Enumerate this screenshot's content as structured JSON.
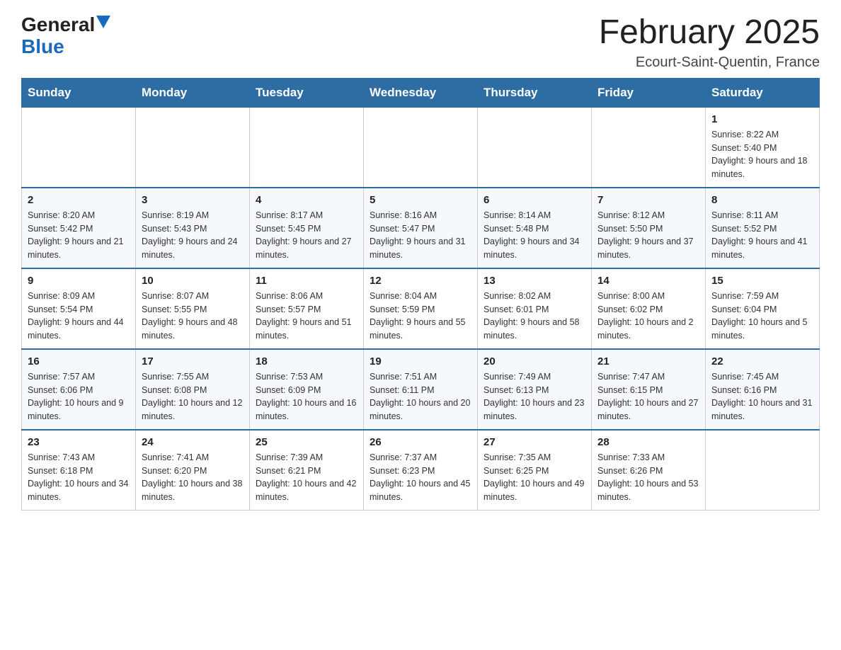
{
  "header": {
    "logo_general": "General",
    "logo_blue": "Blue",
    "month_title": "February 2025",
    "location": "Ecourt-Saint-Quentin, France"
  },
  "days_of_week": [
    "Sunday",
    "Monday",
    "Tuesday",
    "Wednesday",
    "Thursday",
    "Friday",
    "Saturday"
  ],
  "weeks": [
    [
      {
        "day": "",
        "info": ""
      },
      {
        "day": "",
        "info": ""
      },
      {
        "day": "",
        "info": ""
      },
      {
        "day": "",
        "info": ""
      },
      {
        "day": "",
        "info": ""
      },
      {
        "day": "",
        "info": ""
      },
      {
        "day": "1",
        "info": "Sunrise: 8:22 AM\nSunset: 5:40 PM\nDaylight: 9 hours and 18 minutes."
      }
    ],
    [
      {
        "day": "2",
        "info": "Sunrise: 8:20 AM\nSunset: 5:42 PM\nDaylight: 9 hours and 21 minutes."
      },
      {
        "day": "3",
        "info": "Sunrise: 8:19 AM\nSunset: 5:43 PM\nDaylight: 9 hours and 24 minutes."
      },
      {
        "day": "4",
        "info": "Sunrise: 8:17 AM\nSunset: 5:45 PM\nDaylight: 9 hours and 27 minutes."
      },
      {
        "day": "5",
        "info": "Sunrise: 8:16 AM\nSunset: 5:47 PM\nDaylight: 9 hours and 31 minutes."
      },
      {
        "day": "6",
        "info": "Sunrise: 8:14 AM\nSunset: 5:48 PM\nDaylight: 9 hours and 34 minutes."
      },
      {
        "day": "7",
        "info": "Sunrise: 8:12 AM\nSunset: 5:50 PM\nDaylight: 9 hours and 37 minutes."
      },
      {
        "day": "8",
        "info": "Sunrise: 8:11 AM\nSunset: 5:52 PM\nDaylight: 9 hours and 41 minutes."
      }
    ],
    [
      {
        "day": "9",
        "info": "Sunrise: 8:09 AM\nSunset: 5:54 PM\nDaylight: 9 hours and 44 minutes."
      },
      {
        "day": "10",
        "info": "Sunrise: 8:07 AM\nSunset: 5:55 PM\nDaylight: 9 hours and 48 minutes."
      },
      {
        "day": "11",
        "info": "Sunrise: 8:06 AM\nSunset: 5:57 PM\nDaylight: 9 hours and 51 minutes."
      },
      {
        "day": "12",
        "info": "Sunrise: 8:04 AM\nSunset: 5:59 PM\nDaylight: 9 hours and 55 minutes."
      },
      {
        "day": "13",
        "info": "Sunrise: 8:02 AM\nSunset: 6:01 PM\nDaylight: 9 hours and 58 minutes."
      },
      {
        "day": "14",
        "info": "Sunrise: 8:00 AM\nSunset: 6:02 PM\nDaylight: 10 hours and 2 minutes."
      },
      {
        "day": "15",
        "info": "Sunrise: 7:59 AM\nSunset: 6:04 PM\nDaylight: 10 hours and 5 minutes."
      }
    ],
    [
      {
        "day": "16",
        "info": "Sunrise: 7:57 AM\nSunset: 6:06 PM\nDaylight: 10 hours and 9 minutes."
      },
      {
        "day": "17",
        "info": "Sunrise: 7:55 AM\nSunset: 6:08 PM\nDaylight: 10 hours and 12 minutes."
      },
      {
        "day": "18",
        "info": "Sunrise: 7:53 AM\nSunset: 6:09 PM\nDaylight: 10 hours and 16 minutes."
      },
      {
        "day": "19",
        "info": "Sunrise: 7:51 AM\nSunset: 6:11 PM\nDaylight: 10 hours and 20 minutes."
      },
      {
        "day": "20",
        "info": "Sunrise: 7:49 AM\nSunset: 6:13 PM\nDaylight: 10 hours and 23 minutes."
      },
      {
        "day": "21",
        "info": "Sunrise: 7:47 AM\nSunset: 6:15 PM\nDaylight: 10 hours and 27 minutes."
      },
      {
        "day": "22",
        "info": "Sunrise: 7:45 AM\nSunset: 6:16 PM\nDaylight: 10 hours and 31 minutes."
      }
    ],
    [
      {
        "day": "23",
        "info": "Sunrise: 7:43 AM\nSunset: 6:18 PM\nDaylight: 10 hours and 34 minutes."
      },
      {
        "day": "24",
        "info": "Sunrise: 7:41 AM\nSunset: 6:20 PM\nDaylight: 10 hours and 38 minutes."
      },
      {
        "day": "25",
        "info": "Sunrise: 7:39 AM\nSunset: 6:21 PM\nDaylight: 10 hours and 42 minutes."
      },
      {
        "day": "26",
        "info": "Sunrise: 7:37 AM\nSunset: 6:23 PM\nDaylight: 10 hours and 45 minutes."
      },
      {
        "day": "27",
        "info": "Sunrise: 7:35 AM\nSunset: 6:25 PM\nDaylight: 10 hours and 49 minutes."
      },
      {
        "day": "28",
        "info": "Sunrise: 7:33 AM\nSunset: 6:26 PM\nDaylight: 10 hours and 53 minutes."
      },
      {
        "day": "",
        "info": ""
      }
    ]
  ]
}
